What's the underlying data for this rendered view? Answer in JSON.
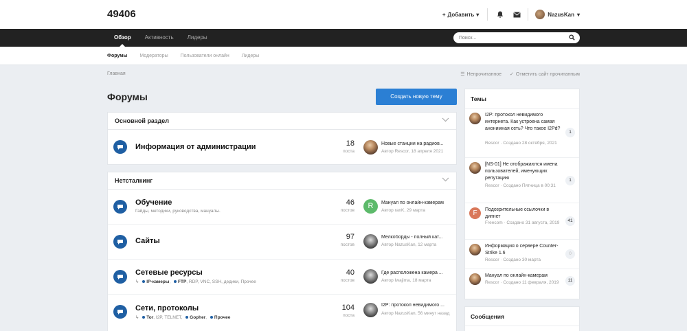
{
  "site": {
    "title": "49406"
  },
  "top_actions": {
    "add_label": "Добавить",
    "user_name": "NazusKan"
  },
  "nav": {
    "tabs": [
      "Обзор",
      "Активность",
      "Лидеры"
    ],
    "active": 0,
    "search_placeholder": "Поиск..."
  },
  "subnav": {
    "tabs": [
      "Форумы",
      "Модераторы",
      "Пользователи онлайн",
      "Лидеры"
    ],
    "active": 0
  },
  "breadcrumb": {
    "home": "Главная"
  },
  "crumb_actions": {
    "unread": "Непрочитанное",
    "mark_read": "Отметить сайт прочитанным"
  },
  "main": {
    "title": "Форумы",
    "create_button": "Создать новую тему"
  },
  "sections": [
    {
      "title": "Основной раздел",
      "forums": [
        {
          "name": "Информация от администрации",
          "desc": "",
          "count": "18",
          "count_label": "поста",
          "last_title": "Новые станции на радиов...",
          "last_meta": "Автор Rescor, 18 апреля 2021"
        }
      ]
    },
    {
      "title": "Нетсталкинг",
      "forums": [
        {
          "name": "Обучение",
          "desc": "Гайды, методики, руководства, мануалы.",
          "count": "46",
          "count_label": "постов",
          "last_title": "Мануал по онлайн-камерам",
          "last_meta": "Автор ranK, 29 марта",
          "last_avatar_letter": "R"
        },
        {
          "name": "Сайты",
          "desc": "",
          "count": "97",
          "count_label": "постов",
          "last_title": "Мелкоборды - полный кат...",
          "last_meta": "Автор NazusKan, 12 марта"
        },
        {
          "name": "Сетевые ресурсы",
          "desc_items": [
            "IP-камеры",
            "FTP",
            "RDP, VNC, SSH, дедики",
            "Прочее"
          ],
          "count": "40",
          "count_label": "постов",
          "last_title": "Где расположена камера ...",
          "last_meta": "Автор Iwajima, 18 марта"
        },
        {
          "name": "Сети, протоколы",
          "desc_items": [
            "Tor",
            "I2P",
            "TELNET",
            "Gopher",
            "Прочее"
          ],
          "count": "104",
          "count_label": "поста",
          "last_title": "I2P: протокол невидимого ...",
          "last_meta": "Автор NazusKan, 56 минут назад"
        }
      ]
    }
  ],
  "sidebar": {
    "topics_title": "Темы",
    "topics": [
      {
        "title": "I2P: протокол невидимого интернета. Как устроена самая анонимная сеть? Что такое I2Pd?",
        "meta": "Rescor · Создано 28 октября, 2021",
        "count": "1"
      },
      {
        "title": "[NS-01] Не отображаются имена пользователей, именующих репутацию",
        "meta": "Rescor · Создано Пятница в 00:31",
        "count": "1"
      },
      {
        "title": "Подозрительные ссылочки в дипнет",
        "meta": "Freecom · Создано 31 августа, 2019",
        "count": "41",
        "avatar_letter": "F"
      },
      {
        "title": "Информация о сервере Counter-Strike 1.6",
        "meta": "Rescor · Создано 30 марта",
        "count": "0"
      },
      {
        "title": "Мануал по онлайн-камерам",
        "meta": "Rescor · Создано 11 февраля, 2019",
        "count": "11"
      }
    ],
    "messages_title": "Сообщения"
  },
  "colors": {
    "accent": "#2b7fd4",
    "forum_icon": "#1f5fa3",
    "navbar": "#222222"
  }
}
